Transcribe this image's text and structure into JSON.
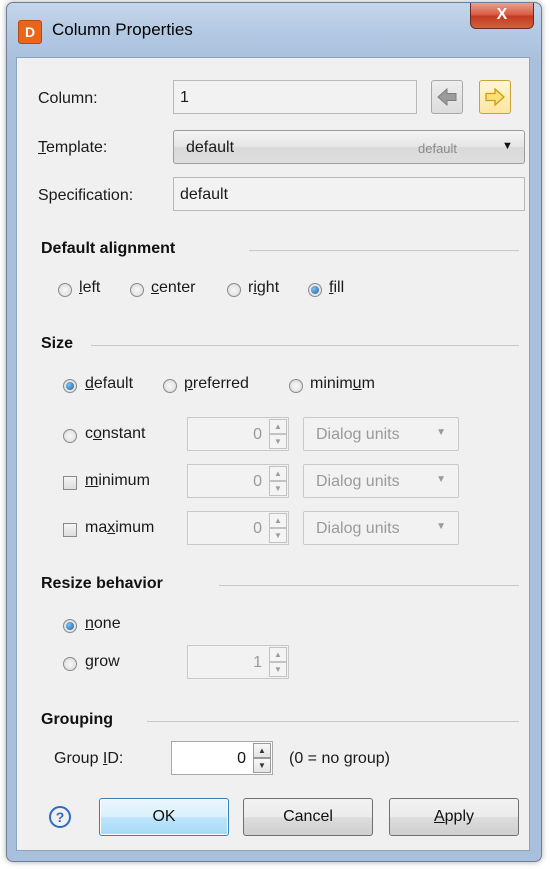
{
  "window": {
    "title": "Column Properties",
    "app_icon_letter": "D",
    "close_glyph": "X"
  },
  "column": {
    "label": "Column:",
    "value": "1"
  },
  "template": {
    "label": "Template:",
    "value": "default",
    "hint": "default"
  },
  "specification": {
    "label": "Specification:",
    "value": "default"
  },
  "default_alignment": {
    "title": "Default alignment",
    "options": [
      "left",
      "center",
      "right",
      "fill"
    ],
    "selected": "fill"
  },
  "size": {
    "title": "Size",
    "options": [
      "default",
      "preferred",
      "minimum"
    ],
    "selected": "default",
    "constant": {
      "label": "constant",
      "value": "0",
      "unit": "Dialog units"
    },
    "minimum": {
      "label": "minimum",
      "value": "0",
      "unit": "Dialog units",
      "checked": false
    },
    "maximum": {
      "label": "maximum",
      "value": "0",
      "unit": "Dialog units",
      "checked": false
    }
  },
  "resize_behavior": {
    "title": "Resize behavior",
    "none_label": "none",
    "grow_label": "grow",
    "grow_value": "1",
    "selected": "none"
  },
  "grouping": {
    "title": "Grouping",
    "group_id_label": "Group ID:",
    "group_id_value": "0",
    "hint": "(0 = no group)"
  },
  "buttons": {
    "help": "?",
    "ok": "OK",
    "cancel": "Cancel",
    "apply": "Apply"
  },
  "icons": {
    "app": "app-logo-icon",
    "prev": "arrow-left-icon",
    "next": "arrow-right-icon",
    "help": "help-icon"
  },
  "colors": {
    "accent": "#1c5fa8",
    "app_icon": "#e8651a",
    "close_button": "#c13b21"
  }
}
